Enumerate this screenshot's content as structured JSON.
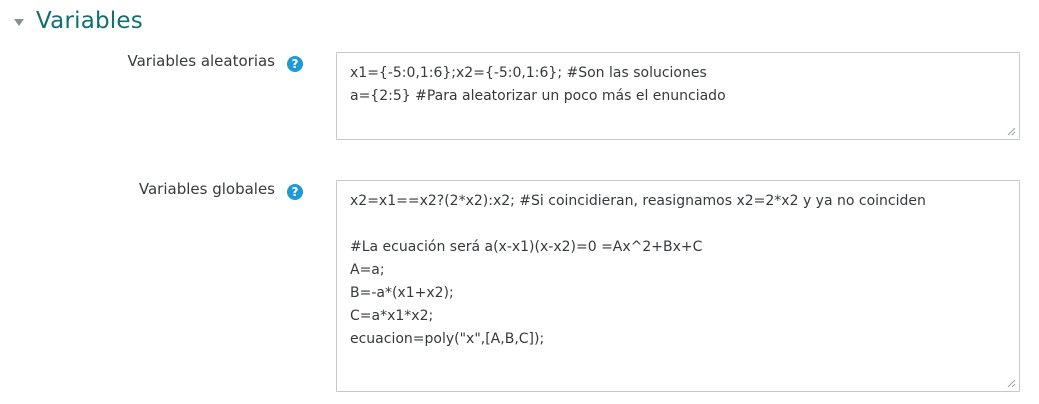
{
  "section": {
    "title": "Variables"
  },
  "fields": {
    "random_vars": {
      "label": "Variables aleatorias",
      "help_icon": "question-circle-icon",
      "value": "x1={-5:0,1:6};x2={-5:0,1:6}; #Son las soluciones\na={2:5} #Para aleatorizar un poco más el enunciado"
    },
    "global_vars": {
      "label": "Variables globales",
      "help_icon": "question-circle-icon",
      "value": "x2=x1==x2?(2*x2):x2; #Si coincidieran, reasignamos x2=2*x2 y ya no coinciden\n\n#La ecuación será a(x-x1)(x-x2)=0 =Ax^2+Bx+C\nA=a;\nB=-a*(x1+x2);\nC=a*x1*x2;\necuacion=poly(\"x\",[A,B,C]);"
    }
  },
  "colors": {
    "title": "#0f6f71",
    "help_icon": "#1e9bd7",
    "border": "#c6c9cc"
  }
}
